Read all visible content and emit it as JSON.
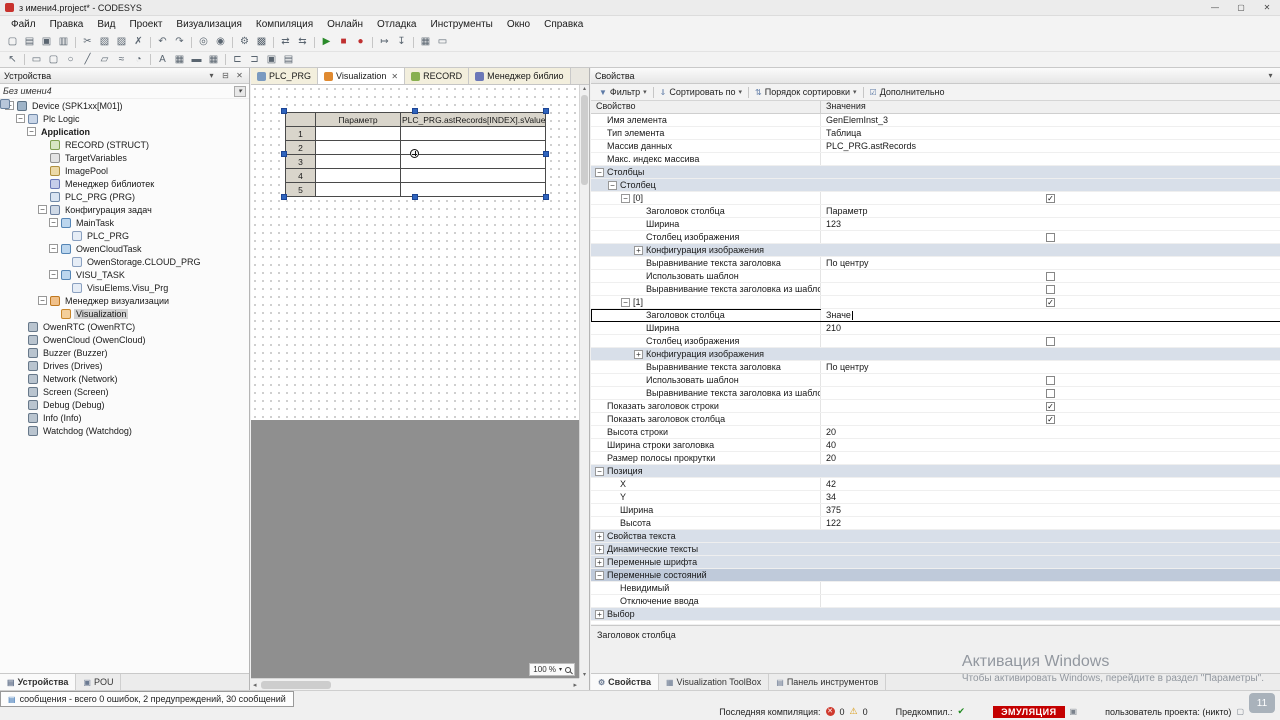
{
  "window": {
    "title": "з имени4.project* - CODESYS",
    "watermark_line1": "Активация Windows",
    "watermark_line2": "Чтобы активировать Windows, перейдите в раздел \"Параметры\".",
    "rec_badge": "11"
  },
  "menubar": {
    "items": [
      "Файл",
      "Правка",
      "Вид",
      "Проект",
      "Визуализация",
      "Компиляция",
      "Онлайн",
      "Отладка",
      "Инструменты",
      "Окно",
      "Справка"
    ]
  },
  "toolbars": {
    "main": [
      {
        "n": "new-project-icon",
        "g": "▢"
      },
      {
        "n": "open-project-icon",
        "g": "▤"
      },
      {
        "n": "save-icon",
        "g": "▣"
      },
      {
        "n": "print-icon",
        "g": "▥"
      },
      "sep",
      {
        "n": "cut-icon",
        "g": "✂"
      },
      {
        "n": "copy-icon",
        "g": "▧"
      },
      {
        "n": "paste-icon",
        "g": "▨"
      },
      {
        "n": "delete-icon",
        "g": "✗"
      },
      "sep",
      {
        "n": "undo-icon",
        "g": "↶"
      },
      {
        "n": "redo-icon",
        "g": "↷"
      },
      "sep",
      {
        "n": "find-icon",
        "g": "◎"
      },
      {
        "n": "replace-icon",
        "g": "◉"
      },
      "sep",
      {
        "n": "compile-icon",
        "g": "⚙"
      },
      {
        "n": "rebuild-icon",
        "g": "▩"
      },
      "sep",
      {
        "n": "login-icon",
        "g": "⇄"
      },
      {
        "n": "logout-icon",
        "g": "⇆"
      },
      "sep",
      {
        "n": "start-icon",
        "g": "▶",
        "c": "#2a8a2a"
      },
      {
        "n": "stop-icon",
        "g": "■",
        "c": "#c03030"
      },
      {
        "n": "breakpoint-icon",
        "g": "●",
        "c": "#c03030"
      },
      "sep",
      {
        "n": "step-over-icon",
        "g": "↦"
      },
      {
        "n": "step-into-icon",
        "g": "↧"
      },
      "sep",
      {
        "n": "monitor-icon",
        "g": "▦"
      },
      {
        "n": "options-icon",
        "g": "▭"
      }
    ],
    "visu": [
      {
        "n": "pointer-icon",
        "g": "↖"
      },
      "sep",
      {
        "n": "rectangle-icon",
        "g": "▭"
      },
      {
        "n": "rounded-rect-icon",
        "g": "▢"
      },
      {
        "n": "ellipse-icon",
        "g": "○"
      },
      {
        "n": "line-icon",
        "g": "╱"
      },
      {
        "n": "polygon-icon",
        "g": "▱"
      },
      {
        "n": "curve-icon",
        "g": "≈"
      },
      {
        "n": "pie-icon",
        "g": "◔"
      },
      "sep",
      {
        "n": "text-icon",
        "g": "A"
      },
      {
        "n": "image-icon",
        "g": "▦"
      },
      {
        "n": "button-icon",
        "g": "▬"
      },
      {
        "n": "table-icon",
        "g": "▦"
      },
      "sep",
      {
        "n": "align-left-icon",
        "g": "⊏"
      },
      {
        "n": "align-right-icon",
        "g": "⊐"
      },
      {
        "n": "group-icon",
        "g": "▣"
      },
      {
        "n": "order-icon",
        "g": "▤"
      }
    ]
  },
  "devices_panel": {
    "title": "Устройства",
    "root": "Без имени4",
    "items": [
      {
        "ind": 0,
        "exp": "-",
        "icon": "device",
        "label": "Device (SPK1xx[M01])"
      },
      {
        "ind": 1,
        "exp": "-",
        "icon": "plc",
        "label": "Plc Logic"
      },
      {
        "ind": 2,
        "exp": "-",
        "icon": "app",
        "label": "Application",
        "bold": true
      },
      {
        "ind": 3,
        "icon": "struct",
        "label": "RECORD (STRUCT)"
      },
      {
        "ind": 3,
        "icon": "gvl",
        "label": "TargetVariables"
      },
      {
        "ind": 3,
        "icon": "img",
        "label": "ImagePool"
      },
      {
        "ind": 3,
        "icon": "lib",
        "label": "Менеджер библиотек"
      },
      {
        "ind": 3,
        "icon": "pou",
        "label": "PLC_PRG (PRG)"
      },
      {
        "ind": 3,
        "exp": "-",
        "icon": "task-cfg",
        "label": "Конфигурация задач"
      },
      {
        "ind": 4,
        "exp": "-",
        "icon": "task",
        "label": "MainTask"
      },
      {
        "ind": 5,
        "icon": "pou-call",
        "label": "PLC_PRG"
      },
      {
        "ind": 4,
        "exp": "-",
        "icon": "task",
        "label": "OwenCloudTask"
      },
      {
        "ind": 5,
        "icon": "pou-call",
        "label": "OwenStorage.CLOUD_PRG"
      },
      {
        "ind": 4,
        "exp": "-",
        "icon": "task",
        "label": "VISU_TASK"
      },
      {
        "ind": 5,
        "icon": "pou-call",
        "label": "VisuElems.Visu_Prg"
      },
      {
        "ind": 3,
        "exp": "-",
        "icon": "visu-mgr",
        "label": "Менеджер визуализации"
      },
      {
        "ind": 4,
        "icon": "visu",
        "label": "Visualization",
        "selected": true
      },
      {
        "ind": 1,
        "icon": "owdev",
        "label": "OwenRTC (OwenRTC)"
      },
      {
        "ind": 1,
        "icon": "owdev",
        "label": "OwenCloud (OwenCloud)"
      },
      {
        "ind": 1,
        "icon": "owdev",
        "label": "Buzzer (Buzzer)"
      },
      {
        "ind": 1,
        "icon": "owdev",
        "label": "Drives (Drives)"
      },
      {
        "ind": 1,
        "icon": "owdev",
        "label": "Network (Network)"
      },
      {
        "ind": 1,
        "icon": "owdev",
        "label": "Screen (Screen)"
      },
      {
        "ind": 1,
        "icon": "owdev",
        "label": "Debug (Debug)"
      },
      {
        "ind": 1,
        "icon": "owdev",
        "label": "Info (Info)"
      },
      {
        "ind": 1,
        "icon": "owdev",
        "label": "Watchdog (Watchdog)"
      }
    ],
    "tabs": [
      {
        "name": "tab-devices",
        "label": "Устройства",
        "glyph": "▤",
        "active": true
      },
      {
        "name": "tab-pou",
        "label": "POU",
        "glyph": "▣",
        "active": false
      }
    ]
  },
  "editor": {
    "tabs": [
      {
        "name": "tab-plc-prg",
        "label": "PLC_PRG",
        "color": "#7a9ac0",
        "active": false,
        "close": false
      },
      {
        "name": "tab-visualization",
        "label": "Visualization",
        "color": "#e08a30",
        "active": true,
        "close": true
      },
      {
        "name": "tab-record",
        "label": "RECORD",
        "color": "#88b050",
        "active": false,
        "close": false
      },
      {
        "name": "tab-library-manager",
        "label": "Менеджер библио",
        "color": "#6c78b8",
        "active": false,
        "close": false
      }
    ],
    "zoom": "100 %",
    "table": {
      "columns": [
        "Параметр",
        "PLC_PRG.astRecords[INDEX].sValue"
      ],
      "rows": [
        "1",
        "2",
        "3",
        "4",
        "5"
      ]
    }
  },
  "properties_panel": {
    "title": "Свойства",
    "toolbar": [
      {
        "name": "filter-button",
        "glyph": "▼",
        "label": "Фильтр",
        "caret": true
      },
      {
        "name": "sort-by-button",
        "glyph": "⇓",
        "label": "Сортировать по",
        "caret": true
      },
      {
        "name": "sort-order-button",
        "glyph": "⇅",
        "label": "Порядок сортировки",
        "caret": true
      },
      {
        "name": "advanced-toggle",
        "glyph": "☑",
        "label": "Дополнительно",
        "caret": false
      }
    ],
    "grid_header": [
      "Свойство",
      "Значения"
    ],
    "rows": [
      {
        "ind": 0,
        "label": "Имя элемента",
        "value": "GenElemInst_3"
      },
      {
        "ind": 0,
        "label": "Тип элемента",
        "value": "Таблица"
      },
      {
        "ind": 0,
        "label": "Массив данных",
        "value": "PLC_PRG.astRecords"
      },
      {
        "ind": 0,
        "label": "Макс. индекс массива",
        "value": ""
      },
      {
        "ind": 0,
        "exp": "-",
        "group": true,
        "label": "Столбцы"
      },
      {
        "ind": 1,
        "exp": "-",
        "group": true,
        "label": "Столбец"
      },
      {
        "ind": 2,
        "exp": "-",
        "label": "[0]",
        "chk": true
      },
      {
        "ind": 3,
        "label": "Заголовок столбца",
        "value": "Параметр"
      },
      {
        "ind": 3,
        "label": "Ширина",
        "value": "123"
      },
      {
        "ind": 3,
        "label": "Столбец изображения",
        "chk": false
      },
      {
        "ind": 3,
        "exp": "+",
        "group": true,
        "label": "Конфигурация изображения"
      },
      {
        "ind": 3,
        "label": "Выравнивание текста заголовка",
        "value": "По центру"
      },
      {
        "ind": 3,
        "label": "Использовать шаблон",
        "chk": false
      },
      {
        "ind": 3,
        "label": "Выравнивание текста заголовка из шаблона",
        "chk": false
      },
      {
        "ind": 2,
        "exp": "-",
        "label": "[1]",
        "chk": true
      },
      {
        "ind": 3,
        "label": "Заголовок столбца",
        "edit": true,
        "value": "Значе"
      },
      {
        "ind": 3,
        "label": "Ширина",
        "value": "210"
      },
      {
        "ind": 3,
        "label": "Столбец изображения",
        "chk": false
      },
      {
        "ind": 3,
        "exp": "+",
        "group": true,
        "label": "Конфигурация изображения"
      },
      {
        "ind": 3,
        "label": "Выравнивание текста заголовка",
        "value": "По центру"
      },
      {
        "ind": 3,
        "label": "Использовать шаблон",
        "chk": false
      },
      {
        "ind": 3,
        "label": "Выравнивание текста заголовка из шаблона",
        "chk": false
      },
      {
        "ind": 0,
        "label": "Показать заголовок строки",
        "chk": true
      },
      {
        "ind": 0,
        "label": "Показать заголовок столбца",
        "chk": true
      },
      {
        "ind": 0,
        "label": "Высота строки",
        "value": "20"
      },
      {
        "ind": 0,
        "label": "Ширина строки заголовка",
        "value": "40"
      },
      {
        "ind": 0,
        "label": "Размер полосы прокрутки",
        "value": "20"
      },
      {
        "ind": 0,
        "exp": "-",
        "group": true,
        "label": "Позиция"
      },
      {
        "ind": 1,
        "label": "X",
        "value": "42"
      },
      {
        "ind": 1,
        "label": "Y",
        "value": "34"
      },
      {
        "ind": 1,
        "label": "Ширина",
        "value": "375"
      },
      {
        "ind": 1,
        "label": "Высота",
        "value": "122"
      },
      {
        "ind": 0,
        "exp": "+",
        "group": true,
        "label": "Свойства текста"
      },
      {
        "ind": 0,
        "exp": "+",
        "group": true,
        "label": "Динамические тексты"
      },
      {
        "ind": 0,
        "exp": "+",
        "group": true,
        "label": "Переменные шрифта"
      },
      {
        "ind": 0,
        "exp": "-",
        "group": true,
        "sel": true,
        "label": "Переменные состояний"
      },
      {
        "ind": 1,
        "label": "Невидимый",
        "value": ""
      },
      {
        "ind": 1,
        "label": "Отключение ввода",
        "value": ""
      },
      {
        "ind": 0,
        "exp": "+",
        "group": true,
        "label": "Выбор"
      }
    ],
    "footer": "Заголовок столбца",
    "tabs": [
      {
        "name": "tab-properties",
        "label": "Свойства",
        "glyph": "⚙",
        "active": true
      },
      {
        "name": "tab-visualization-toolbox",
        "label": "Visualization ToolBox",
        "glyph": "▦",
        "active": false
      },
      {
        "name": "tab-tool-panel",
        "label": "Панель инструментов",
        "glyph": "▤",
        "active": false
      }
    ]
  },
  "statusbar": {
    "messages": "сообщения - всего 0 ошибок, 2 предупреждений, 30 сообщений",
    "last_compile_label": "Последняя компиляция:",
    "errors": "0",
    "warnings": "0",
    "precompile_label": "Предкомпил.:",
    "run_state": "ЭМУЛЯЦИЯ",
    "project_user": "пользователь проекта: (никто)"
  }
}
